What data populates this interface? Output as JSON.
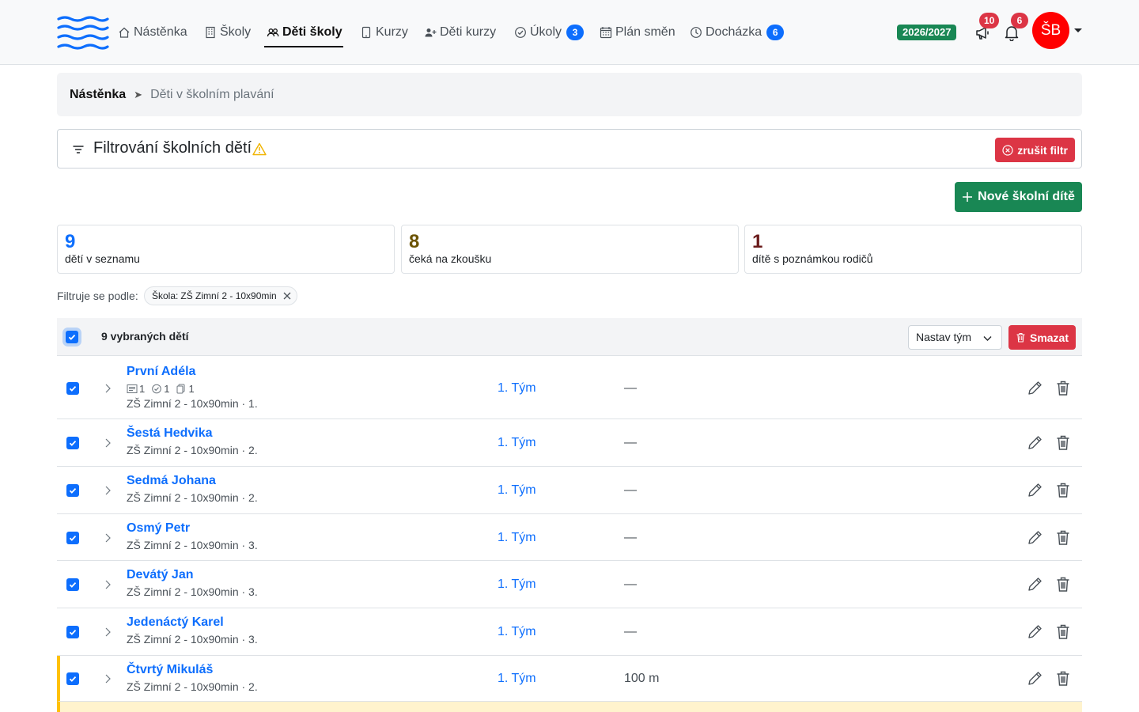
{
  "nav": {
    "items": [
      {
        "label": "Nástěnka",
        "icon": "home-icon"
      },
      {
        "label": "Školy",
        "icon": "building-icon"
      },
      {
        "label": "Děti školy",
        "icon": "people-icon",
        "active": true
      },
      {
        "label": "Kurzy",
        "icon": "tablet-icon"
      },
      {
        "label": "Děti kurzy",
        "icon": "person-plus-icon"
      },
      {
        "label": "Úkoly",
        "icon": "check-circle-icon",
        "badge": "3"
      },
      {
        "label": "Plán směn",
        "icon": "calendar-icon"
      },
      {
        "label": "Docházka",
        "icon": "clock-icon",
        "badge": "6"
      }
    ],
    "season": "2026/2027",
    "announcements_count": "10",
    "notifications_count": "6",
    "avatar_initials": "ŠB"
  },
  "breadcrumb": {
    "home": "Nástěnka",
    "separator": "➤",
    "current": "Děti v školním plavání"
  },
  "filter": {
    "title": "Filtrování školních dětí",
    "clear_label": "zrušit filtr"
  },
  "new_button_label": "Nové školní dítě",
  "stats": [
    {
      "value": "9",
      "label": "dětí v seznamu",
      "color": "#0d6efd"
    },
    {
      "value": "8",
      "label": "čeká na zkoušku",
      "color": "#6b5300"
    },
    {
      "value": "1",
      "label": "dítě s poznámkou rodičů",
      "color": "#6a1a1a"
    }
  ],
  "active_filters": {
    "label": "Filtruje se podle:",
    "chip_key": "Škola:",
    "chip_value": "ZŠ Zimní 2 - 10x90min"
  },
  "bulk": {
    "count_label": "9 vybraných dětí",
    "team_select": "Nastav tým",
    "delete_label": "Smazat"
  },
  "rows": [
    {
      "name": "První Adéla",
      "meta": "ZŠ Zimní 2 - 10x90min · 1.",
      "team": "1. Tým",
      "distance": "—",
      "indicators": {
        "notes": "1",
        "tasks": "1",
        "docs": "1"
      }
    },
    {
      "name": "Šestá Hedvika",
      "meta": "ZŠ Zimní 2 - 10x90min · 2.",
      "team": "1. Tým",
      "distance": "—"
    },
    {
      "name": "Sedmá Johana",
      "meta": "ZŠ Zimní 2 - 10x90min · 2.",
      "team": "1. Tým",
      "distance": "—"
    },
    {
      "name": "Osmý Petr",
      "meta": "ZŠ Zimní 2 - 10x90min · 3.",
      "team": "1. Tým",
      "distance": "—"
    },
    {
      "name": "Devátý Jan",
      "meta": "ZŠ Zimní 2 - 10x90min · 3.",
      "team": "1. Tým",
      "distance": "—"
    },
    {
      "name": "Jedenáctý Karel",
      "meta": "ZŠ Zimní 2 - 10x90min · 3.",
      "team": "1. Tým",
      "distance": "—"
    },
    {
      "name": "Čtvrtý Mikuláš",
      "meta": "ZŠ Zimní 2 - 10x90min · 2.",
      "team": "1. Tým",
      "distance": "100 m",
      "flagged": true
    }
  ]
}
